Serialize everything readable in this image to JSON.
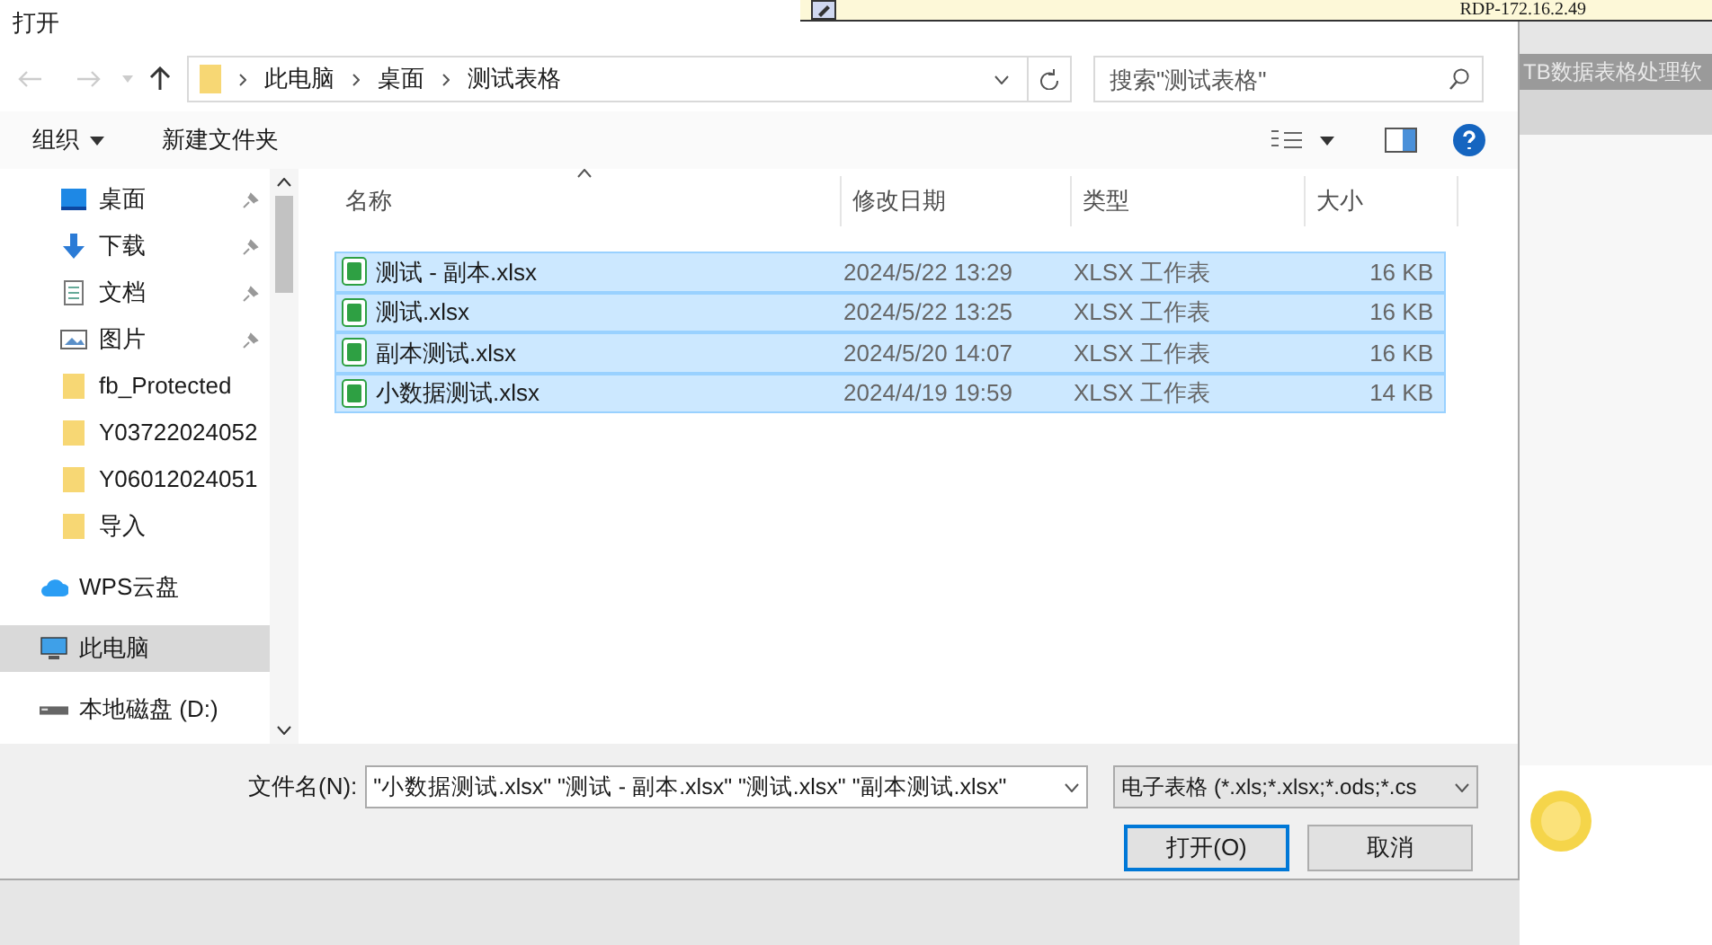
{
  "window": {
    "title": "打开"
  },
  "remote_bar": {
    "label": "RDP-172.16.2.49"
  },
  "background_app": {
    "title": "TB数据表格处理软"
  },
  "breadcrumb": [
    "此电脑",
    "桌面",
    "测试表格"
  ],
  "search": {
    "placeholder": "搜索\"测试表格\""
  },
  "toolbar": {
    "organize": "组织",
    "new_folder": "新建文件夹"
  },
  "sidebar": {
    "items": [
      {
        "kind": "desktop",
        "label": "桌面",
        "pinned": true,
        "selected": false
      },
      {
        "kind": "download",
        "label": "下载",
        "pinned": true,
        "selected": false
      },
      {
        "kind": "document",
        "label": "文档",
        "pinned": true,
        "selected": false
      },
      {
        "kind": "picture",
        "label": "图片",
        "pinned": true,
        "selected": false
      },
      {
        "kind": "folder",
        "label": "fb_Protected",
        "pinned": false,
        "selected": false
      },
      {
        "kind": "folder",
        "label": "Y03722024052",
        "pinned": false,
        "selected": false
      },
      {
        "kind": "folder",
        "label": "Y06012024051",
        "pinned": false,
        "selected": false
      },
      {
        "kind": "folder",
        "label": "导入",
        "pinned": false,
        "selected": false
      },
      {
        "kind": "cloud",
        "label": "WPS云盘",
        "pinned": false,
        "selected": false
      },
      {
        "kind": "computer",
        "label": "此电脑",
        "pinned": false,
        "selected": true
      },
      {
        "kind": "drive",
        "label": "本地磁盘 (D:)",
        "pinned": false,
        "selected": false
      }
    ]
  },
  "table": {
    "columns": [
      "名称",
      "修改日期",
      "类型",
      "大小"
    ],
    "rows": [
      {
        "name": "测试 - 副本.xlsx",
        "date": "2024/5/22 13:29",
        "type": "XLSX 工作表",
        "size": "16 KB",
        "selected": true
      },
      {
        "name": "测试.xlsx",
        "date": "2024/5/22 13:25",
        "type": "XLSX 工作表",
        "size": "16 KB",
        "selected": true
      },
      {
        "name": "副本测试.xlsx",
        "date": "2024/5/20 14:07",
        "type": "XLSX 工作表",
        "size": "16 KB",
        "selected": true
      },
      {
        "name": "小数据测试.xlsx",
        "date": "2024/4/19 19:59",
        "type": "XLSX 工作表",
        "size": "14 KB",
        "selected": true
      }
    ]
  },
  "file_name": {
    "label": "文件名(N):",
    "value": "\"小数据测试.xlsx\" \"测试 - 副本.xlsx\" \"测试.xlsx\" \"副本测试.xlsx\""
  },
  "file_type": {
    "value": "电子表格 (*.xls;*.xlsx;*.ods;*.cs"
  },
  "buttons": {
    "open": "打开(O)",
    "cancel": "取消"
  }
}
